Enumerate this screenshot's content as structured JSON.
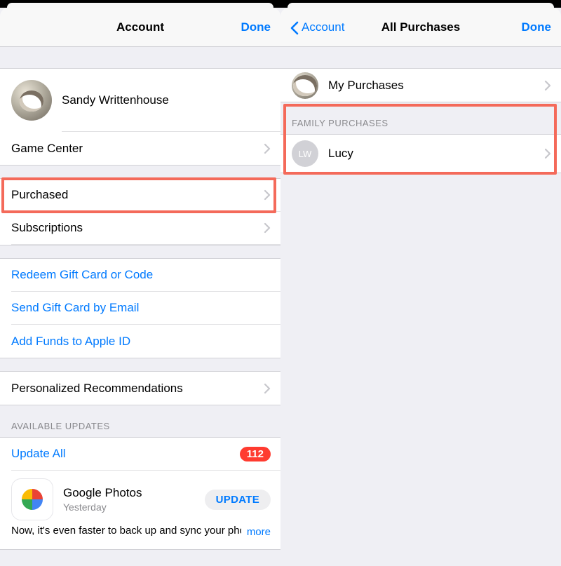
{
  "left": {
    "nav": {
      "title": "Account",
      "done": "Done"
    },
    "profile_name": "Sandy Writtenhouse",
    "rows": {
      "game_center": "Game Center",
      "purchased": "Purchased",
      "subscriptions": "Subscriptions",
      "redeem": "Redeem Gift Card or Code",
      "send_gift": "Send Gift Card by Email",
      "add_funds": "Add Funds to Apple ID",
      "recommendations": "Personalized Recommendations"
    },
    "updates": {
      "header": "AVAILABLE UPDATES",
      "update_all": "Update All",
      "badge": "112",
      "app": {
        "name": "Google Photos",
        "sub": "Yesterday",
        "button": "UPDATE",
        "desc": "Now, it's even faster to back up and sync your photos.",
        "more": "more"
      }
    }
  },
  "right": {
    "nav": {
      "back": "Account",
      "title": "All Purchases",
      "done": "Done"
    },
    "my_purchases": "My Purchases",
    "family_header": "FAMILY PURCHASES",
    "family_member": {
      "initials": "LW",
      "name": "Lucy"
    }
  }
}
